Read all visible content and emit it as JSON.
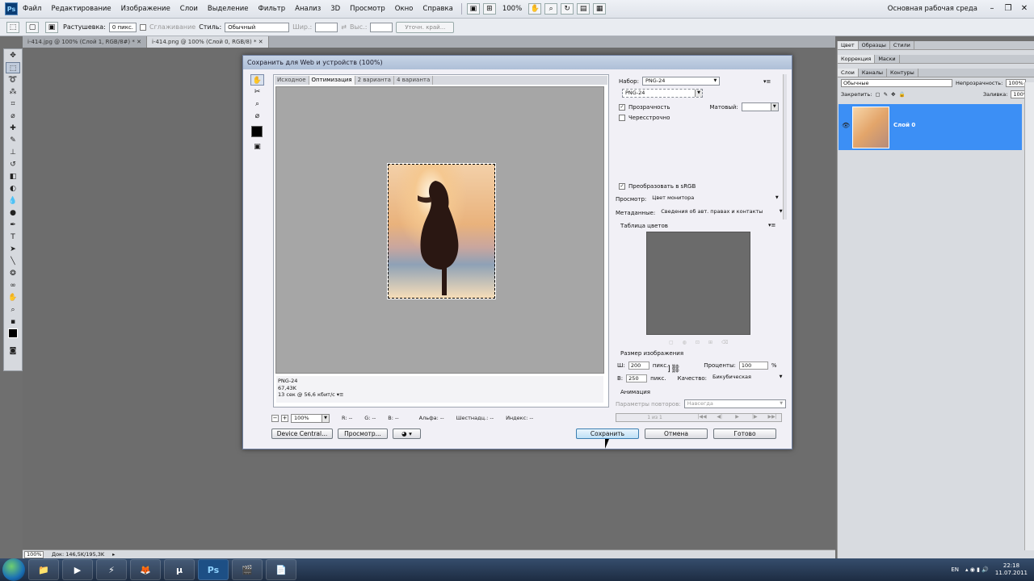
{
  "menubar": {
    "logo": "Ps",
    "items": [
      "Файл",
      "Редактирование",
      "Изображение",
      "Слои",
      "Выделение",
      "Фильтр",
      "Анализ",
      "3D",
      "Просмотр",
      "Окно",
      "Справка"
    ],
    "zoom": "100%",
    "workspace": "Основная рабочая среда"
  },
  "optbar": {
    "feather_label": "Растушевка:",
    "feather_value": "0 пикс.",
    "antialias_label": "Сглаживание",
    "style_label": "Стиль:",
    "style_value": "Обычный",
    "width_label": "Шир.:",
    "height_label": "Выс.:",
    "refine_button": "Уточн. край..."
  },
  "doc_tabs": [
    "i-414.jpg @ 100% (Слой 1, RGB/8#) *",
    "i-414.png @ 100% (Слой 0, RGB/8) *"
  ],
  "statusbar": {
    "zoom": "100%",
    "doc_info": "Док: 146,5K/195,3K"
  },
  "panels": {
    "top_tabs": [
      "Цвет",
      "Образцы",
      "Стили"
    ],
    "mid_tabs": [
      "Коррекция",
      "Маски"
    ],
    "layer_tabs": [
      "Слои",
      "Каналы",
      "Контуры"
    ],
    "blend_mode": "Обычные",
    "opacity_label": "Непрозрачность:",
    "opacity_value": "100%",
    "lock_label": "Закрепить:",
    "fill_label": "Заливка:",
    "fill_value": "100%",
    "layer_name": "Слой 0"
  },
  "taskbar": {
    "apps": [
      "📁",
      "▶",
      "⚡",
      "🦊",
      "µ",
      "Ps",
      "🎬",
      "📄"
    ],
    "lang": "EN",
    "time": "22:18",
    "date": "11.07.2011"
  },
  "dialog": {
    "title": "Сохранить для Web и устройств (100%)",
    "tabs": [
      "Исходное",
      "Оптимизация",
      "2 варианта",
      "4 варианта"
    ],
    "preview_info": {
      "format": "PNG-24",
      "size": "67,43K",
      "time": "13 сек @ 56,6 кбит/с"
    },
    "zoom_value": "100%",
    "stats": {
      "r": "R: --",
      "g": "G: --",
      "b": "B: --",
      "alpha": "Альфа: --",
      "hex": "Шестнадц.: --",
      "index": "Индекс: --"
    },
    "buttons": {
      "device_central": "Device Central...",
      "preview": "Просмотр...",
      "save": "Сохранить",
      "cancel": "Отмена",
      "done": "Готово"
    },
    "settings": {
      "preset_label": "Набор:",
      "preset_value": "PNG-24",
      "format_value": "PNG-24",
      "transparency_label": "Прозрачность",
      "matte_label": "Матовый:",
      "interlaced_label": "Чересстрочно",
      "srgb_label": "Преобразовать в sRGB",
      "preview_label": "Просмотр:",
      "preview_value": "Цвет монитора",
      "metadata_label": "Метаданные:",
      "metadata_value": "Сведения об авт. правах и контакты",
      "color_table_label": "Таблица цветов",
      "image_size_label": "Размер изображения",
      "width_label": "Ш:",
      "width_value": "200",
      "height_label": "В:",
      "height_value": "250",
      "px": "пикс.",
      "percent_label": "Проценты:",
      "percent_value": "100",
      "percent_sign": "%",
      "quality_label": "Качество:",
      "quality_value": "Бикубическая",
      "animation_label": "Анимация",
      "loop_label": "Параметры повторов:",
      "loop_value": "Навсегда",
      "frame_counter": "1 из 1"
    }
  },
  "colors": {
    "accent": "#3c8ff5",
    "canvas": "#6d6d6d",
    "preview_bg": "#a6a6a6"
  }
}
